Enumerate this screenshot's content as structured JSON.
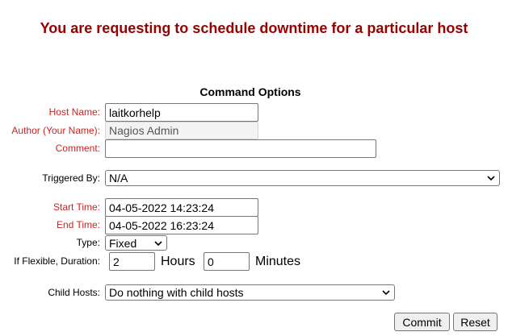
{
  "page_title": "You are requesting to schedule downtime for a particular host",
  "section_title": "Command Options",
  "fields": {
    "host_name": {
      "label": "Host Name:",
      "value": "laitkorhelp"
    },
    "author": {
      "label": "Author (Your Name):",
      "value": "Nagios Admin"
    },
    "comment": {
      "label": "Comment:",
      "value": ""
    },
    "triggered_by": {
      "label": "Triggered By:",
      "value": "N/A"
    },
    "start_time": {
      "label": "Start Time:",
      "value": "04-05-2022 14:23:24"
    },
    "end_time": {
      "label": "End Time:",
      "value": "04-05-2022 16:23:24"
    },
    "type": {
      "label": "Type:",
      "value": "Fixed"
    },
    "duration": {
      "label": "If Flexible, Duration:",
      "hours_value": "2",
      "hours_unit": "Hours",
      "minutes_value": "0",
      "minutes_unit": "Minutes"
    },
    "child_hosts": {
      "label": "Child Hosts:",
      "value": "Do nothing with child hosts"
    }
  },
  "buttons": {
    "commit": "Commit",
    "reset": "Reset"
  },
  "colors": {
    "title": "#990000",
    "required_label": "#cc2222",
    "optional_label": "#000000"
  },
  "icons": {
    "select_arrow": "chevron-down-icon"
  }
}
